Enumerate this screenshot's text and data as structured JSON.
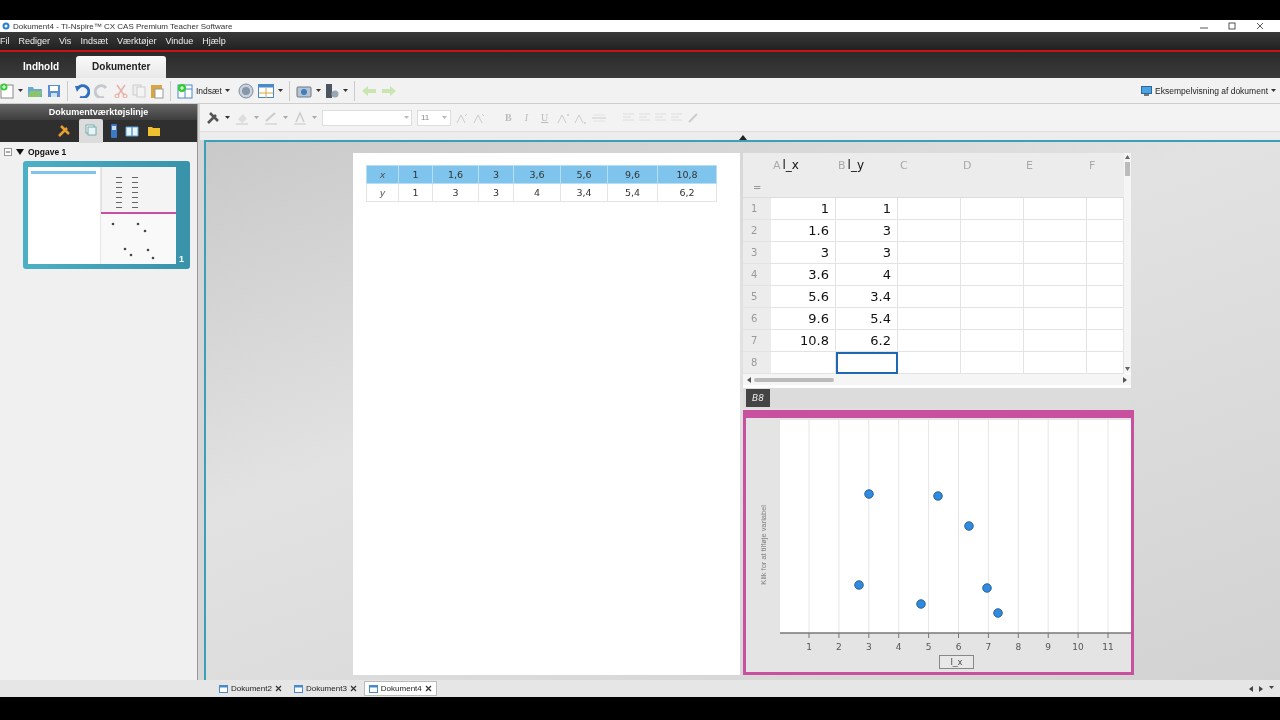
{
  "window": {
    "title": "Dokument4 - TI-Nspire™ CX CAS Premium Teacher Software"
  },
  "menu": [
    "Fil",
    "Rediger",
    "Vis",
    "Indsæt",
    "Værktøjer",
    "Vindue",
    "Hjælp"
  ],
  "tabs": [
    {
      "label": "Indhold",
      "selected": false
    },
    {
      "label": "Dokumenter",
      "selected": true
    }
  ],
  "toolbar": {
    "insert_label": "Indsæt",
    "preview_label": "Eksempelvisning af dokument"
  },
  "format_bar": {
    "font_size": "11",
    "disabled": true,
    "buttons": [
      "B",
      "I",
      "U"
    ]
  },
  "sidebar": {
    "title": "Dokumentværktøjslinje",
    "problem": "Opgave 1",
    "expanded": true,
    "page_number": "1"
  },
  "table": {
    "rows": [
      {
        "label": "x",
        "cells": [
          "1",
          "1,6",
          "3",
          "3,6",
          "5,6",
          "9,6",
          "10,8"
        ]
      },
      {
        "label": "y",
        "cells": [
          "1",
          "3",
          "3",
          "4",
          "3,4",
          "5,4",
          "6,2"
        ]
      }
    ]
  },
  "spreadsheet": {
    "columns": [
      {
        "letter": "A",
        "name": "l_x"
      },
      {
        "letter": "B",
        "name": "l_y"
      },
      {
        "letter": "C"
      },
      {
        "letter": "D"
      },
      {
        "letter": "E"
      },
      {
        "letter": "F"
      }
    ],
    "formula_marker": "=",
    "rows": [
      {
        "number": "1",
        "cells": [
          {
            "value": "1",
            "selected": false
          },
          {
            "value": "1",
            "selected": false
          }
        ]
      },
      {
        "number": "2",
        "cells": [
          {
            "value": "1.6",
            "selected": false
          },
          {
            "value": "3",
            "selected": false
          }
        ]
      },
      {
        "number": "3",
        "cells": [
          {
            "value": "3",
            "selected": false
          },
          {
            "value": "3",
            "selected": false
          }
        ]
      },
      {
        "number": "4",
        "cells": [
          {
            "value": "3.6",
            "selected": false
          },
          {
            "value": "4",
            "selected": false
          }
        ]
      },
      {
        "number": "5",
        "cells": [
          {
            "value": "5.6",
            "selected": false
          },
          {
            "value": "3.4",
            "selected": false
          }
        ]
      },
      {
        "number": "6",
        "cells": [
          {
            "value": "9.6",
            "selected": false
          },
          {
            "value": "5.4",
            "selected": false
          }
        ]
      },
      {
        "number": "7",
        "cells": [
          {
            "value": "10.8",
            "selected": false
          },
          {
            "value": "6.2",
            "selected": false
          }
        ]
      },
      {
        "number": "8",
        "cells": [
          {
            "selected": false
          },
          {
            "selected": true
          }
        ]
      }
    ],
    "cell_reference": "B8"
  },
  "plot": {
    "y_prompt": "Klik for at tilføje variabel",
    "x_variable": "l_x",
    "x_ticks": [
      "1",
      "2",
      "3",
      "4",
      "5",
      "6",
      "7",
      "8",
      "9",
      "10",
      "11"
    ]
  },
  "document_tabs": [
    {
      "label": "Dokument2",
      "selected": false
    },
    {
      "label": "Dokument3",
      "selected": false
    },
    {
      "label": "Dokument4",
      "selected": true
    }
  ]
}
